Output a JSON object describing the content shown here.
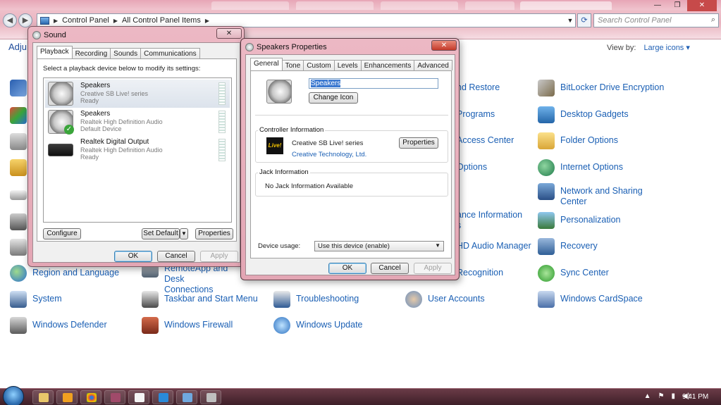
{
  "explorer": {
    "breadcrumbs": [
      "Control Panel",
      "All Control Panel Items"
    ],
    "search_placeholder": "Search Control Panel",
    "adjust_label": "Adju",
    "view_by_label": "View by:",
    "view_by_value": "Large icons"
  },
  "cp_items": [
    {
      "label": "nd Restore"
    },
    {
      "label": "BitLocker Drive Encryption"
    },
    {
      "label": "Programs"
    },
    {
      "label": "Desktop Gadgets"
    },
    {
      "label": "Access Center"
    },
    {
      "label": "Folder Options"
    },
    {
      "label": "Options"
    },
    {
      "label": "Internet Options"
    },
    {
      "label": "Network and Sharing Center"
    },
    {
      "label": "ance Information"
    },
    {
      "label": "s"
    },
    {
      "label": "Personalization"
    },
    {
      "label": "HD Audio Manager"
    },
    {
      "label": "Recovery"
    },
    {
      "label": "Region and Language"
    },
    {
      "label": "RemoteApp and Desk"
    },
    {
      "label": "Connections"
    },
    {
      "label": "Recognition"
    },
    {
      "label": "Sync Center"
    },
    {
      "label": "System"
    },
    {
      "label": "Taskbar and Start Menu"
    },
    {
      "label": "Troubleshooting"
    },
    {
      "label": "User Accounts"
    },
    {
      "label": "Windows CardSpace"
    },
    {
      "label": "Windows Defender"
    },
    {
      "label": "Windows Firewall"
    },
    {
      "label": "Windows Update"
    }
  ],
  "sound": {
    "title": "Sound",
    "tabs": [
      "Playback",
      "Recording",
      "Sounds",
      "Communications"
    ],
    "instruction": "Select a playback device below to modify its settings:",
    "devices": [
      {
        "name": "Speakers",
        "desc": "Creative SB Live! series",
        "status": "Ready"
      },
      {
        "name": "Speakers",
        "desc": "Realtek High Definition Audio",
        "status": "Default Device"
      },
      {
        "name": "Realtek Digital Output",
        "desc": "Realtek High Definition Audio",
        "status": "Ready"
      }
    ],
    "configure": "Configure",
    "set_default": "Set Default",
    "properties": "Properties",
    "ok": "OK",
    "cancel": "Cancel",
    "apply": "Apply"
  },
  "props": {
    "title": "Speakers Properties",
    "tabs": [
      "General",
      "Tone",
      "Custom",
      "Levels",
      "Enhancements",
      "Advanced"
    ],
    "name_value": "Speakers",
    "change_icon": "Change Icon",
    "controller_label": "Controller Information",
    "controller_name": "Creative SB Live! series",
    "controller_vendor": "Creative Technology, Ltd.",
    "controller_logo": "Live!",
    "properties": "Properties",
    "jack_label": "Jack Information",
    "jack_text": "No Jack Information Available",
    "device_usage_label": "Device usage:",
    "device_usage_value": "Use this device (enable)",
    "ok": "OK",
    "cancel": "Cancel",
    "apply": "Apply"
  },
  "taskbar": {
    "clock": "9:41 PM"
  }
}
